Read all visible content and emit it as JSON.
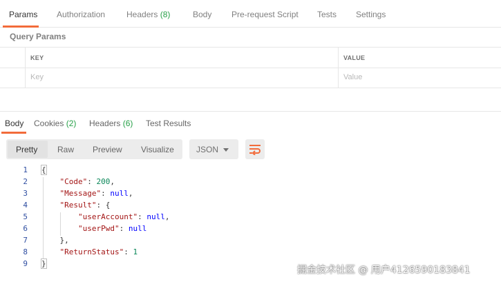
{
  "request_tabs": [
    {
      "label": "Params",
      "active": true
    },
    {
      "label": "Authorization"
    },
    {
      "label": "Headers",
      "count": "(8)"
    },
    {
      "label": "Body"
    },
    {
      "label": "Pre-request Script"
    },
    {
      "label": "Tests"
    },
    {
      "label": "Settings"
    }
  ],
  "query_params": {
    "title": "Query Params",
    "headers": {
      "key": "KEY",
      "value": "VALUE"
    },
    "placeholders": {
      "key": "Key",
      "value": "Value"
    }
  },
  "response_tabs": [
    {
      "label": "Body",
      "active": true
    },
    {
      "label": "Cookies",
      "count": "(2)"
    },
    {
      "label": "Headers",
      "count": "(6)"
    },
    {
      "label": "Test Results"
    }
  ],
  "view_options": [
    "Pretty",
    "Raw",
    "Preview",
    "Visualize"
  ],
  "format": "JSON",
  "icons": {
    "wrap": "wrap-lines-icon",
    "dropdown": "chevron-down-icon"
  },
  "colors": {
    "accent": "#f26b3a",
    "count": "#26a047",
    "json_key": "#a31515",
    "json_number": "#098658",
    "json_null": "#0000ff"
  },
  "code_lines": [
    {
      "n": "1",
      "parts": [
        {
          "t": "{",
          "c": "p"
        }
      ]
    },
    {
      "n": "2",
      "parts": [
        {
          "t": "    ",
          "c": "p"
        },
        {
          "t": "\"Code\"",
          "c": "k"
        },
        {
          "t": ": ",
          "c": "p"
        },
        {
          "t": "200",
          "c": "n"
        },
        {
          "t": ",",
          "c": "p"
        }
      ]
    },
    {
      "n": "3",
      "parts": [
        {
          "t": "    ",
          "c": "p"
        },
        {
          "t": "\"Message\"",
          "c": "k"
        },
        {
          "t": ": ",
          "c": "p"
        },
        {
          "t": "null",
          "c": "kw"
        },
        {
          "t": ",",
          "c": "p"
        }
      ]
    },
    {
      "n": "4",
      "parts": [
        {
          "t": "    ",
          "c": "p"
        },
        {
          "t": "\"Result\"",
          "c": "k"
        },
        {
          "t": ": {",
          "c": "p"
        }
      ]
    },
    {
      "n": "5",
      "parts": [
        {
          "t": "        ",
          "c": "p"
        },
        {
          "t": "\"userAccount\"",
          "c": "k"
        },
        {
          "t": ": ",
          "c": "p"
        },
        {
          "t": "null",
          "c": "kw"
        },
        {
          "t": ",",
          "c": "p"
        }
      ]
    },
    {
      "n": "6",
      "parts": [
        {
          "t": "        ",
          "c": "p"
        },
        {
          "t": "\"userPwd\"",
          "c": "k"
        },
        {
          "t": ": ",
          "c": "p"
        },
        {
          "t": "null",
          "c": "kw"
        }
      ]
    },
    {
      "n": "7",
      "parts": [
        {
          "t": "    },",
          "c": "p"
        }
      ]
    },
    {
      "n": "8",
      "parts": [
        {
          "t": "    ",
          "c": "p"
        },
        {
          "t": "\"ReturnStatus\"",
          "c": "k"
        },
        {
          "t": ": ",
          "c": "p"
        },
        {
          "t": "1",
          "c": "n"
        }
      ]
    },
    {
      "n": "9",
      "parts": [
        {
          "t": "}",
          "c": "p"
        }
      ]
    }
  ],
  "watermark": "掘金技术社区 @ 用户4126590183841"
}
